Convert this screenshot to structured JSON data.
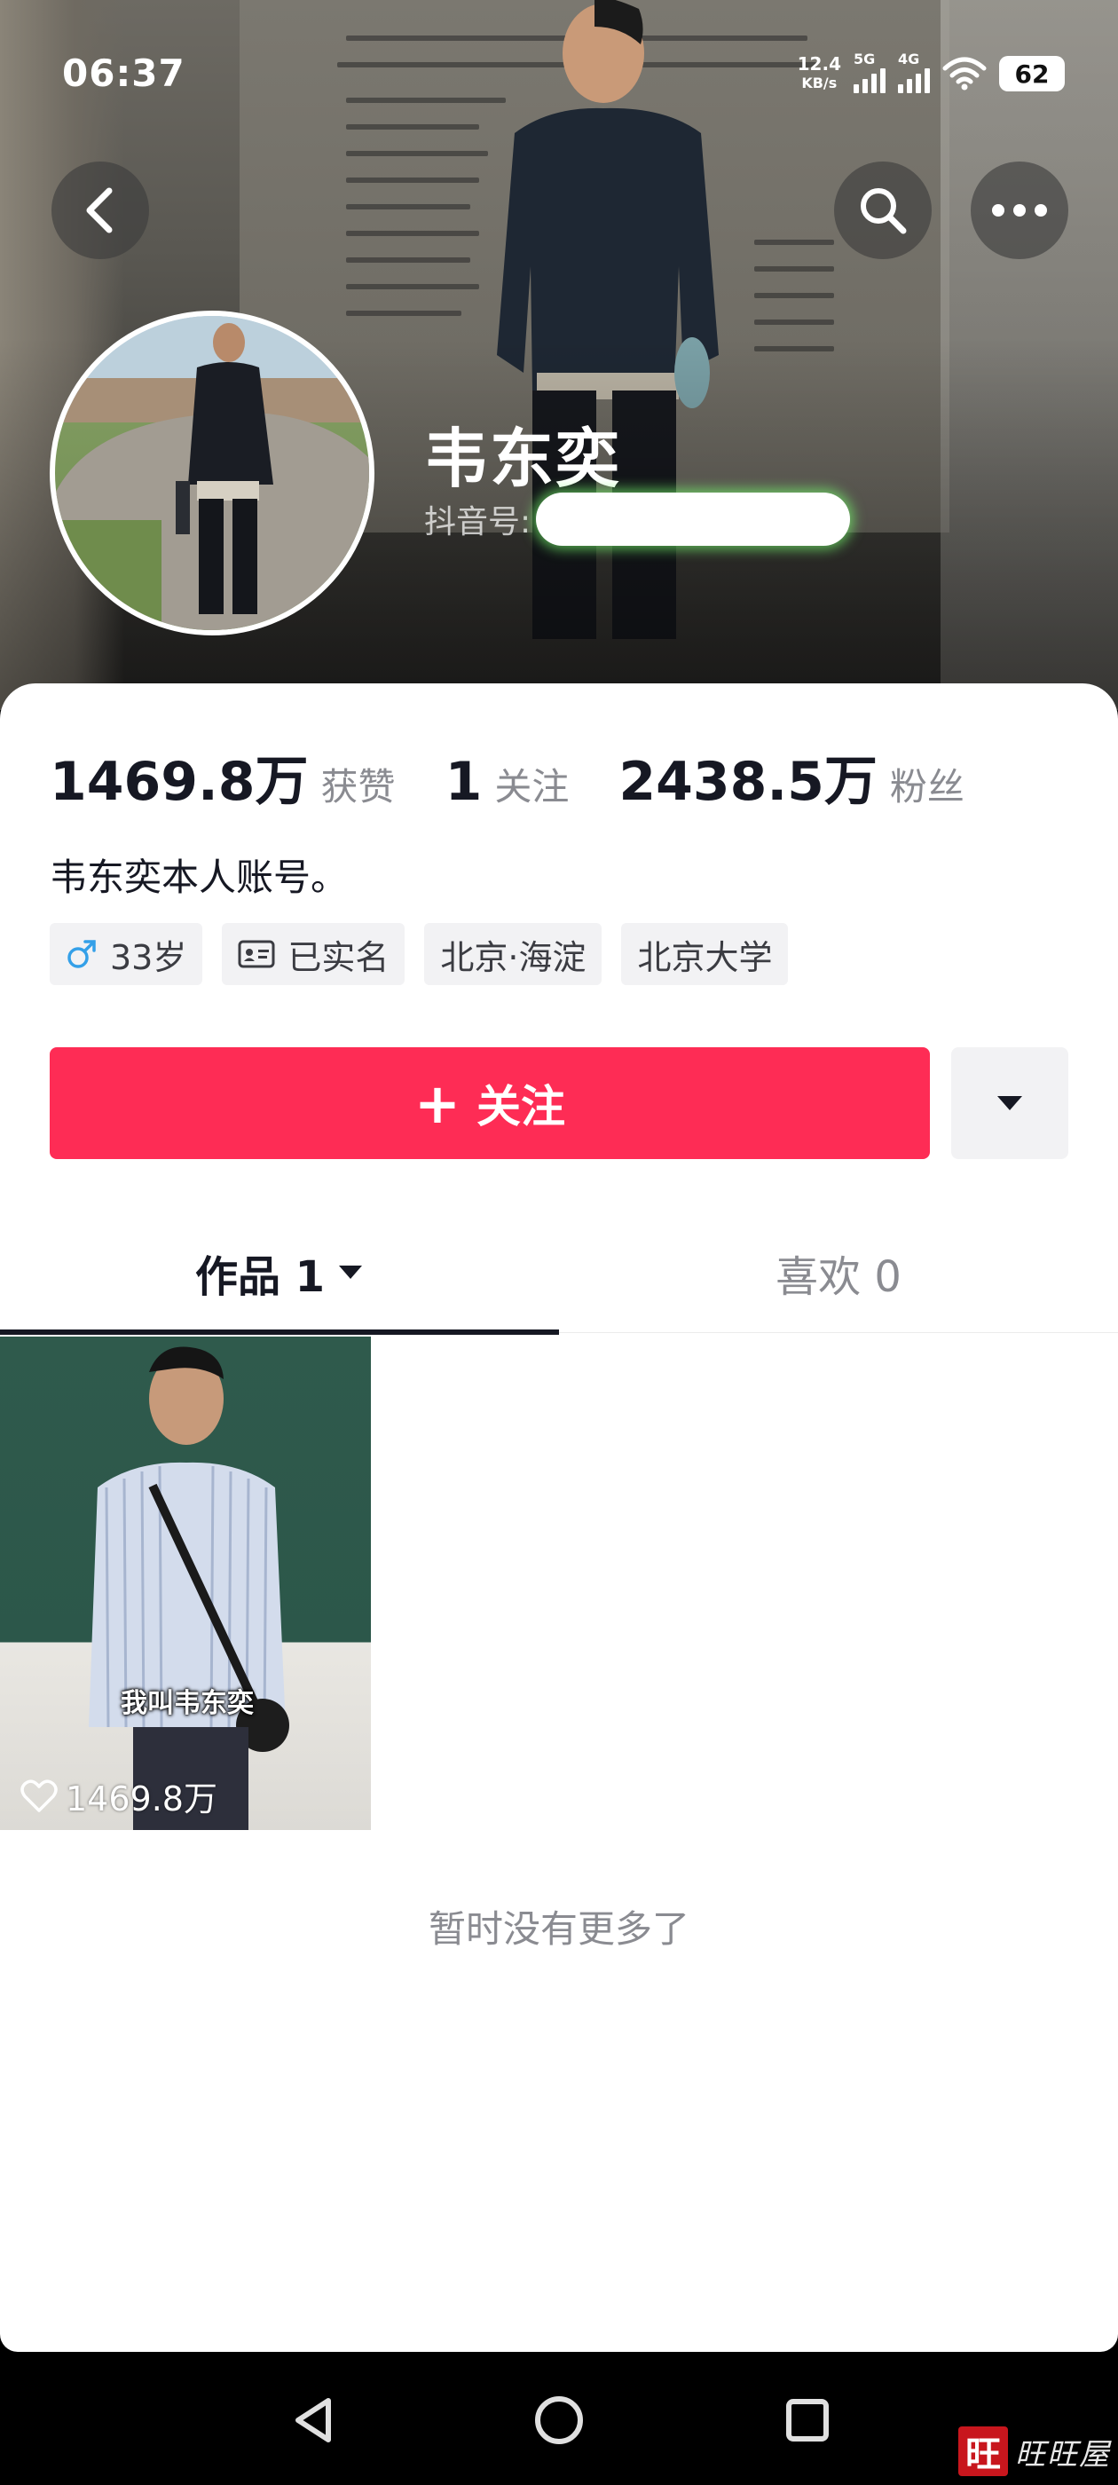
{
  "status_bar": {
    "time": "06:37",
    "net_speed_value": "12.4",
    "net_speed_unit": "KB/s",
    "sim1_label": "5G",
    "sim2_label": "4G",
    "battery": "62"
  },
  "header": {
    "back_icon": "chevron-left-icon",
    "search_icon": "search-icon",
    "more_icon": "more-horizontal-icon"
  },
  "profile": {
    "nickname": "韦东奕",
    "douyin_id_label": "抖音号:",
    "likes_count": "1469.8万",
    "likes_label": "获赞",
    "following_count": "1",
    "following_label": "关注",
    "followers_count": "2438.5万",
    "followers_label": "粉丝",
    "bio": "韦东奕本人账号。",
    "tags": {
      "age": "33岁",
      "verified": "已实名",
      "location": "北京·海淀",
      "school": "北京大学"
    },
    "colors": {
      "follow_button": "#fe2c55",
      "gender_icon": "#34a0e8"
    }
  },
  "actions": {
    "follow_label": "关注",
    "follow_icon": "plus-icon",
    "more_dropdown_icon": "caret-down-icon"
  },
  "tabs": {
    "works_label": "作品 1",
    "likes_label": "喜欢 0"
  },
  "videos": [
    {
      "caption": "我叫韦东奕",
      "likes": "1469.8万"
    }
  ],
  "list_end_text": "暂时没有更多了",
  "watermark": {
    "badge": "旺",
    "text": "旺旺屋"
  }
}
